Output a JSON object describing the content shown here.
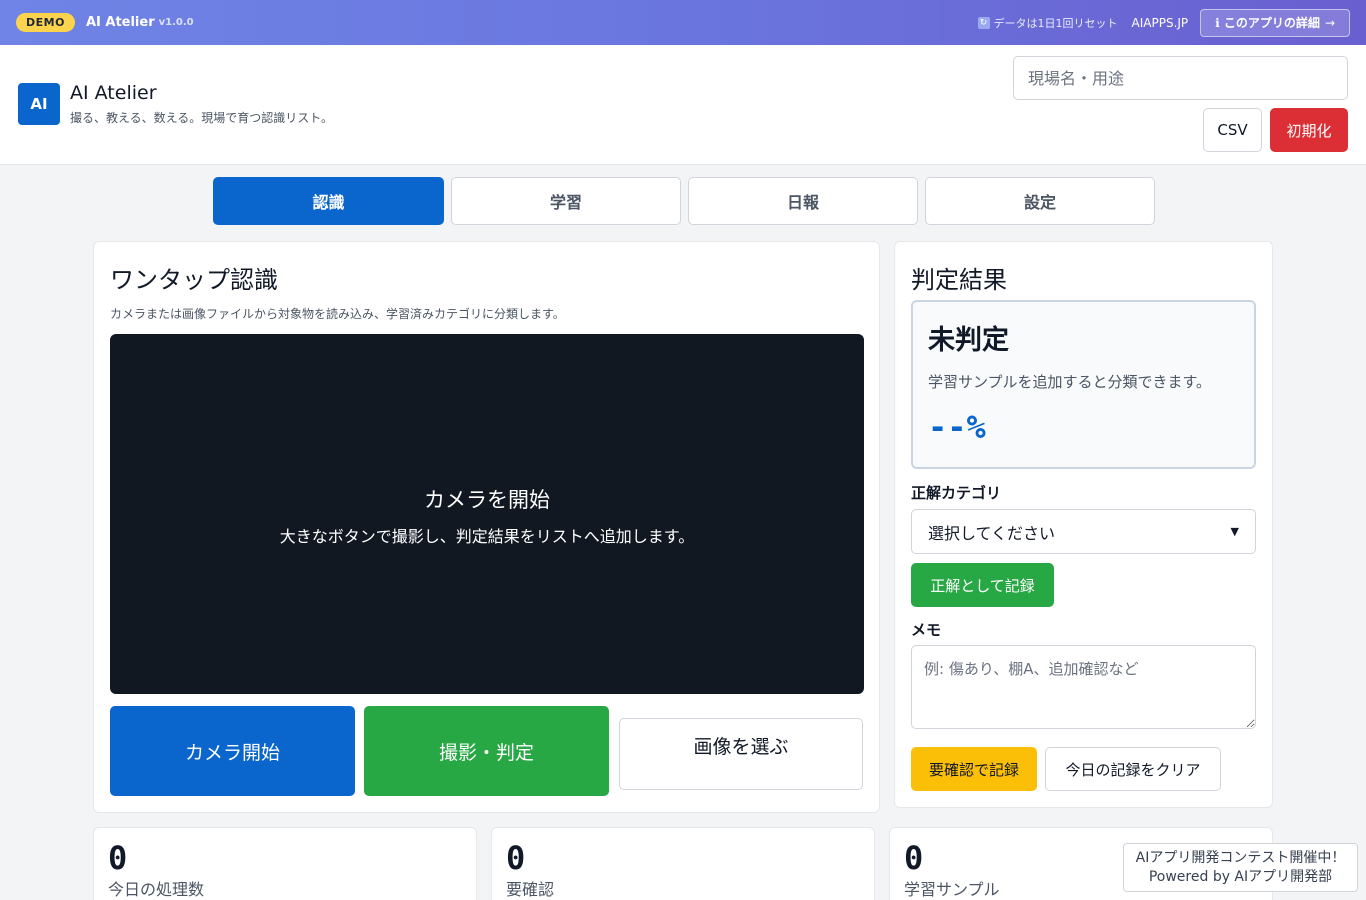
{
  "topbar": {
    "demo_badge": "DEMO",
    "app_name": "AI Atelier",
    "version": "v1.0.0",
    "reset_note": "データは1日1回リセット",
    "site_link": "AIAPPS.JP",
    "details_button": "このアプリの詳細",
    "details_icon": "ℹ",
    "details_arrow": "→"
  },
  "header": {
    "logo_text": "AI",
    "title": "AI Atelier",
    "subtitle": "撮る、教える、数える。現場で育つ認識リスト。",
    "site_placeholder": "現場名・用途",
    "csv_button": "CSV",
    "reset_button": "初期化"
  },
  "tabs": [
    {
      "label": "認識",
      "active": true
    },
    {
      "label": "学習",
      "active": false
    },
    {
      "label": "日報",
      "active": false
    },
    {
      "label": "設定",
      "active": false
    }
  ],
  "recognize": {
    "title": "ワンタップ認識",
    "description": "カメラまたは画像ファイルから対象物を読み込み、学習済みカテゴリに分類します。",
    "camera_title": "カメラを開始",
    "camera_subtitle": "大きなボタンで撮影し、判定結果をリストへ追加します。",
    "start_camera_button": "カメラ開始",
    "capture_button": "撮影・判定",
    "choose_image_button": "画像を選ぶ"
  },
  "result": {
    "title": "判定結果",
    "label": "未判定",
    "hint": "学習サンプルを追加すると分類できます。",
    "confidence": "--%",
    "category_label": "正解カテゴリ",
    "category_selected": "選択してください",
    "record_correct_button": "正解として記録",
    "memo_label": "メモ",
    "memo_placeholder": "例: 傷あり、棚A、追加確認など",
    "record_review_button": "要確認で記録",
    "clear_today_button": "今日の記録をクリア"
  },
  "stats": [
    {
      "value": "0",
      "label": "今日の処理数"
    },
    {
      "value": "0",
      "label": "要確認"
    },
    {
      "value": "0",
      "label": "学習サンプル"
    }
  ],
  "contest": {
    "line1": "AIアプリ開発コンテスト開催中！",
    "line2": "Powered by AIアプリ開発部"
  }
}
